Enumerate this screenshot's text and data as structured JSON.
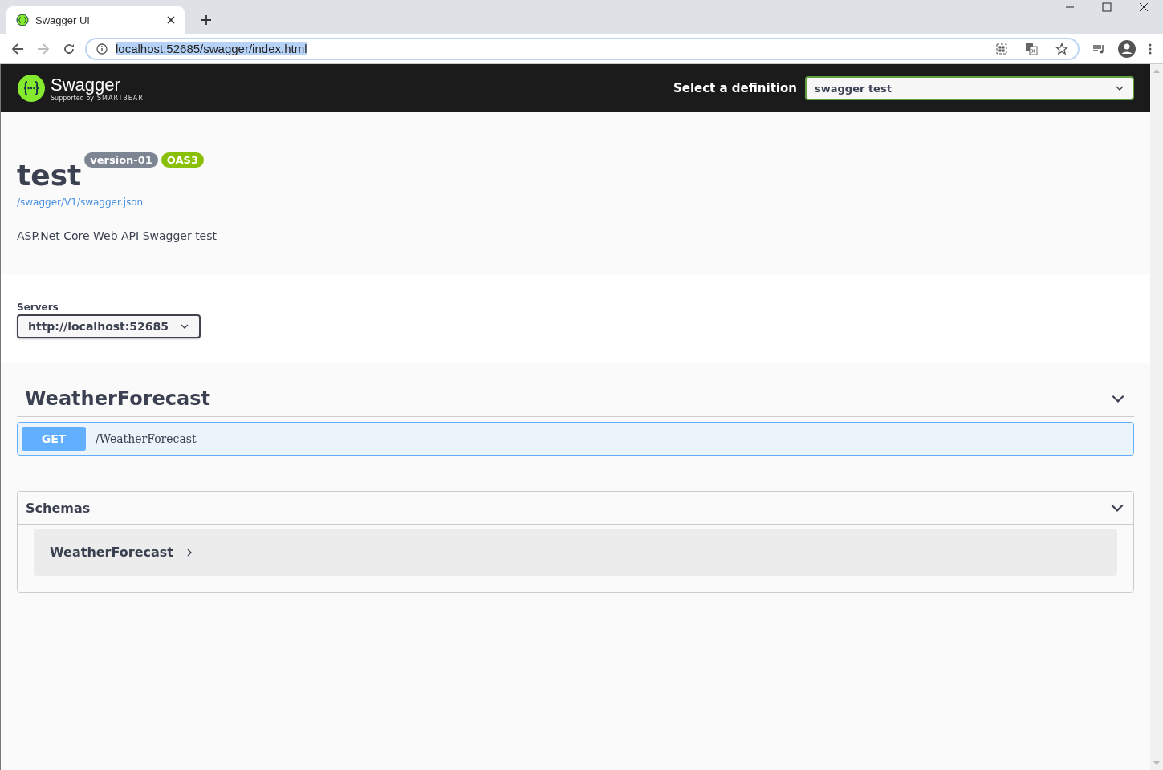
{
  "browser": {
    "tab_title": "Swagger UI",
    "address": "localhost:52685/swagger/index.html"
  },
  "topbar": {
    "logo_text": "Swagger",
    "logo_sub": "Supported by",
    "logo_brand": "SMARTBEAR",
    "definition_label": "Select a definition",
    "definition_value": "swagger test"
  },
  "info": {
    "title": "test",
    "version": "version-01",
    "oas": "OAS3",
    "spec_link": "/swagger/V1/swagger.json",
    "description": "ASP.Net Core Web API Swagger test"
  },
  "servers": {
    "label": "Servers",
    "value": "http://localhost:52685"
  },
  "tags": [
    {
      "name": "WeatherForecast",
      "expanded": true,
      "operations": [
        {
          "method": "GET",
          "path": "/WeatherForecast"
        }
      ]
    }
  ],
  "schemas": {
    "title": "Schemas",
    "expanded": true,
    "models": [
      {
        "name": "WeatherForecast",
        "expanded": false
      }
    ]
  }
}
